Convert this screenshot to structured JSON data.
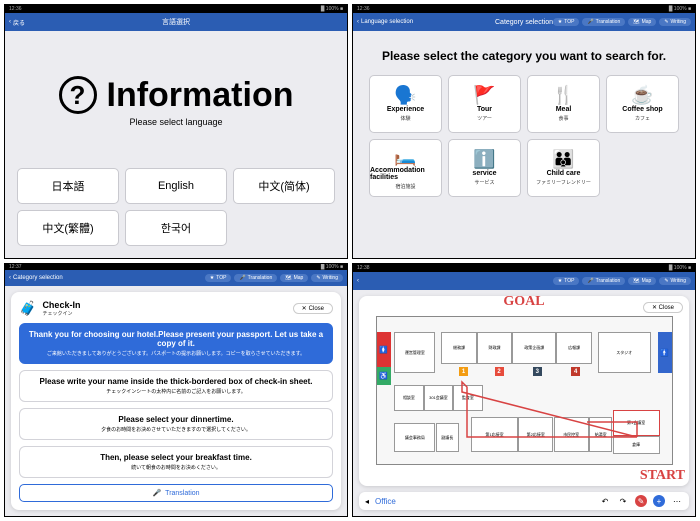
{
  "p1": {
    "nav_back": "戻る",
    "nav_title": "言語選択",
    "title": "Information",
    "subtitle": "Please select language",
    "langs": [
      "日本語",
      "English",
      "中文(简体)",
      "中文(繁體)",
      "한국어"
    ]
  },
  "p2": {
    "nav_back": "Language selection",
    "nav_title": "Category selection",
    "pills": {
      "top": "TOP",
      "trans": "Translation",
      "map": "Map",
      "write": "Writing"
    },
    "prompt": "Please select the category you want to search for.",
    "cats": [
      {
        "icon": "🗣️",
        "en": "Experience",
        "jp": "体験"
      },
      {
        "icon": "🚩",
        "en": "Tour",
        "jp": "ツアー"
      },
      {
        "icon": "🍴",
        "en": "Meal",
        "jp": "食事"
      },
      {
        "icon": "☕",
        "en": "Coffee shop",
        "jp": "カフェ"
      },
      {
        "icon": "🛏️",
        "en": "Accommodation facilities",
        "jp": "宿泊施設"
      },
      {
        "icon": "ℹ️",
        "en": "service",
        "jp": "サービス"
      },
      {
        "icon": "👪",
        "en": "Child care",
        "jp": "ファミリーフレンドリー"
      }
    ]
  },
  "p3": {
    "nav_back": "Category selection",
    "title": "Check-In",
    "sub": "チェックイン",
    "close": "Close",
    "steps": [
      {
        "en": "Thank you for choosing our hotel.Please present your passport. Let us take a copy of it.",
        "jp": "ご来館いただきましてありがとうございます。パスポートの提示お願いします。コピーを取らさせていただきます。"
      },
      {
        "en": "Please write your name inside the thick-bordered box of check-in sheet.",
        "jp": "チェックインシートの太枠内に名前のご記入をお願いします。"
      },
      {
        "en": "Please select your dinnertime.",
        "jp": "夕食のお時間をお決めさせていただきますので選択してください。"
      },
      {
        "en": "Then, please select your breakfast time.",
        "jp": "続いて朝食のお時間をお決めください。"
      }
    ],
    "translation": "Translation"
  },
  "p4": {
    "close": "Close",
    "goal": "GOAL",
    "start": "START",
    "rooms": {
      "r1": "運営管理室",
      "r2": "総務課",
      "r3": "財政課",
      "r4": "政策企画課",
      "r5": "広報課",
      "r6": "スタジオ",
      "r7": "相談室",
      "r8": "301会議室",
      "r9": "監査室",
      "r10": "第1応接室",
      "r11": "第2応接室",
      "r12": "市民控室",
      "r13": "給湯室",
      "r14": "第1会議室",
      "r15": "倉庫",
      "r16": "議会事務局",
      "r17": "副議長"
    },
    "toolbar": {
      "left": "◂",
      "label": "Office",
      "undo": "↶",
      "redo": "↷",
      "pen": "✎",
      "plus": "+",
      "more": "⋯"
    }
  }
}
